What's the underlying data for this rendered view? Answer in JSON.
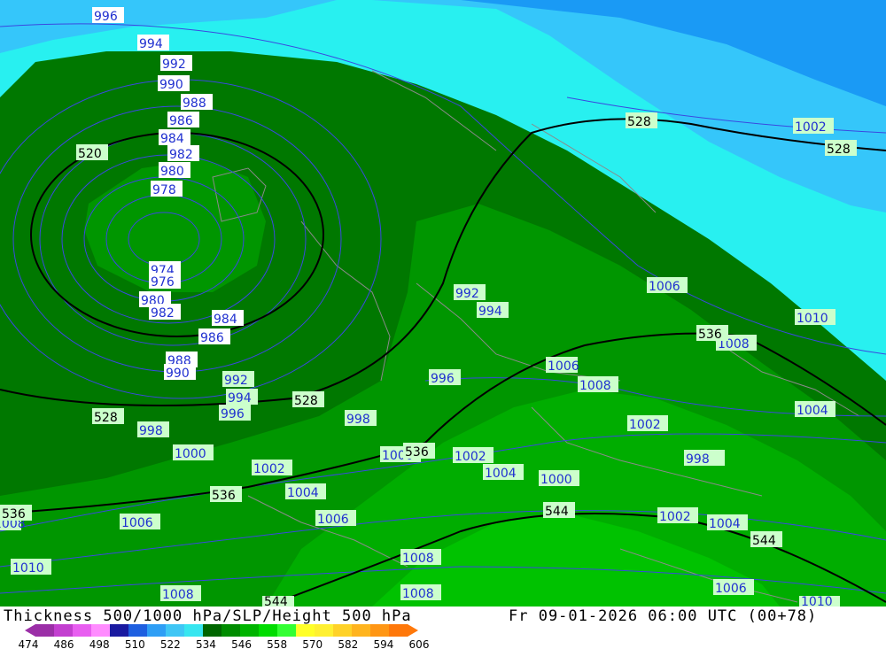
{
  "title": {
    "left": "Thickness 500/1000 hPa/SLP/Height 500 hPa",
    "right": "Fr 09-01-2026 06:00 UTC (00+78)"
  },
  "legend": {
    "ticks": [
      "474",
      "486",
      "498",
      "510",
      "522",
      "534",
      "546",
      "558",
      "570",
      "582",
      "594",
      "606"
    ],
    "colors": [
      "#9b2fa7",
      "#c33fd0",
      "#e85ef0",
      "#ff8cff",
      "#1a1aa0",
      "#1e5fe0",
      "#2e9ef5",
      "#3fc6f5",
      "#37e6f0",
      "#006600",
      "#008c00",
      "#00b400",
      "#00dc00",
      "#32ff32",
      "#ffff28",
      "#fff032",
      "#ffd228",
      "#ffb41e",
      "#ff9614",
      "#ff780a"
    ]
  },
  "map": {
    "colors": {
      "deep_sky": "#1a9af5",
      "sky": "#35c6fa",
      "cyan": "#28f0f0",
      "dark_green": "#007800",
      "mid_green": "#009600",
      "green": "#00ad00",
      "light_green": "#00c200",
      "isobar": "#3a48e0",
      "thickness_line": "#000000",
      "border": "#8a8a8a",
      "label_bg": "#ccffcc",
      "label_blue_text": "#2030d0"
    },
    "slp_labels": [
      "996",
      "994",
      "992",
      "990",
      "988",
      "986",
      "984",
      "982",
      "980",
      "978",
      "974",
      "976",
      "980",
      "982",
      "984",
      "986",
      "988",
      "990",
      "992",
      "994",
      "996",
      "998",
      "1000",
      "1002",
      "1004",
      "1006",
      "1008",
      "1010",
      "992",
      "994",
      "996",
      "998",
      "1000",
      "1002",
      "1004",
      "1006",
      "1008",
      "1002",
      "1006",
      "1008",
      "1010",
      "1004",
      "1006",
      "1008",
      "1002",
      "998",
      "1000",
      "1002",
      "1004",
      "1006",
      "1008",
      "1010",
      "1008",
      "1006",
      "1008",
      "1006",
      "1008",
      "1010"
    ],
    "thickness_labels": [
      "520",
      "528",
      "528",
      "528",
      "528",
      "536",
      "536",
      "536",
      "536",
      "544",
      "544",
      "544"
    ]
  }
}
